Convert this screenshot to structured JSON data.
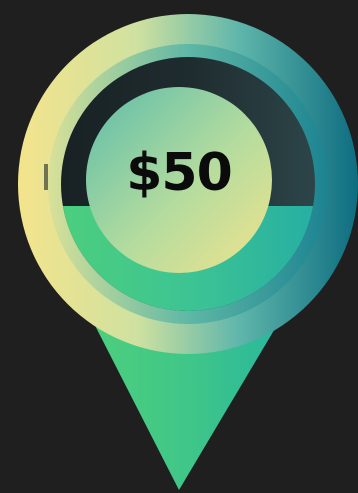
{
  "pin": {
    "price_label": "$50"
  },
  "colors": {
    "background": "#1f1f1f",
    "yellow": "#f1e38c",
    "teal": "#11707e",
    "green": "#43cc7d",
    "dark_band": "#1e2a2d",
    "text": "#0b0b0b"
  }
}
